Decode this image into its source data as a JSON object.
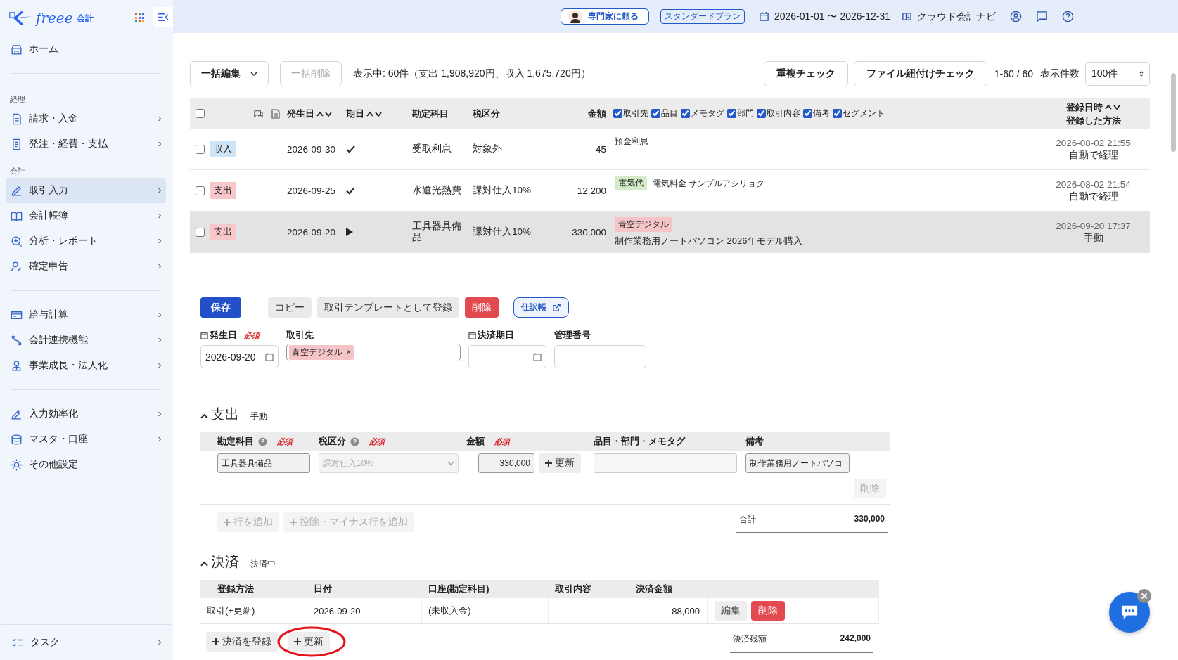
{
  "brand": {
    "name": "freee",
    "product": "会計"
  },
  "header": {
    "expert_button": "専門家に頼る",
    "plan": "スタンダードプラン",
    "period": "2026-01-01 〜 2026-12-31",
    "navi": "クラウド会計ナビ"
  },
  "sidebar": {
    "sections": [
      {
        "groups": [
          {
            "items": [
              {
                "label": "ホーム",
                "selected": false,
                "expandable": false
              }
            ]
          }
        ]
      },
      {
        "groups": [
          {
            "heading": "経理",
            "items": [
              {
                "label": "請求・入金",
                "selected": false,
                "expandable": true
              },
              {
                "label": "発注・経費・支払",
                "selected": false,
                "expandable": true
              }
            ]
          },
          {
            "heading": "会計",
            "items": [
              {
                "label": "取引入力",
                "selected": true,
                "expandable": true
              },
              {
                "label": "会計帳簿",
                "selected": false,
                "expandable": true
              },
              {
                "label": "分析・レポート",
                "selected": false,
                "expandable": true
              },
              {
                "label": "確定申告",
                "selected": false,
                "expandable": true
              }
            ]
          }
        ]
      },
      {
        "groups": [
          {
            "items": [
              {
                "label": "給与計算",
                "selected": false,
                "expandable": true
              },
              {
                "label": "会計連携機能",
                "selected": false,
                "expandable": true
              },
              {
                "label": "事業成長・法人化",
                "selected": false,
                "expandable": true
              }
            ]
          }
        ]
      },
      {
        "groups": [
          {
            "items": [
              {
                "label": "入力効率化",
                "selected": false,
                "expandable": true
              },
              {
                "label": "マスタ・口座",
                "selected": false,
                "expandable": true
              },
              {
                "label": "その他設定",
                "selected": false,
                "expandable": false
              }
            ]
          }
        ]
      }
    ],
    "task": {
      "label": "タスク",
      "expandable": true
    }
  },
  "toolbar": {
    "bulk_edit": "一括編集",
    "bulk_delete": {
      "label": "一括削除",
      "disabled": true
    },
    "summary": "表示中: 60件（支出 1,908,920円、収入 1,675,720円）",
    "buttons": [
      "重複チェック",
      "ファイル紐付けチェック"
    ],
    "range": "1-60 / 60",
    "per_page_label": "表示件数",
    "per_page": "100件"
  },
  "table": {
    "select_all": false,
    "columns": [
      {
        "label": "発生日",
        "sortable": true
      },
      {
        "label": "期日",
        "sortable": true
      },
      {
        "label": "勘定科目",
        "sortable": false
      },
      {
        "label": "税区分",
        "sortable": false
      },
      {
        "label": "金額",
        "sortable": false
      }
    ],
    "filters": [
      {
        "label": "取引先",
        "checked": true
      },
      {
        "label": "品目",
        "checked": true
      },
      {
        "label": "メモタグ",
        "checked": true
      },
      {
        "label": "部門",
        "checked": true
      },
      {
        "label": "取引内容",
        "checked": true
      },
      {
        "label": "備考",
        "checked": true
      },
      {
        "label": "セグメント",
        "checked": true
      }
    ],
    "last_column": {
      "label": "登録日時",
      "sortable": true,
      "sublabel": "登録した方法"
    },
    "rows": [
      {
        "checked": false,
        "selected": false,
        "type": "収入",
        "kind": "income",
        "date": "2026-09-30",
        "settled": true,
        "account": "受取利息",
        "tax": "対象外",
        "amount": "45",
        "detail": [
          {
            "kind": "note",
            "label": "預金利息"
          }
        ],
        "registered": "2026-08-02 21:55",
        "method": "自動で経理"
      },
      {
        "checked": false,
        "selected": false,
        "type": "支出",
        "kind": "expense",
        "date": "2026-09-25",
        "settled": true,
        "account": "水道光熱費",
        "tax": "課対仕入10%",
        "amount": "12,200",
        "detail": [
          {
            "kind": "tag",
            "label": "電気代",
            "color": "#d3ebc6"
          },
          {
            "kind": "note",
            "label": "電気料金 サンプルアシリョク"
          }
        ],
        "registered": "2026-08-02 21:54",
        "method": "自動で経理"
      },
      {
        "checked": false,
        "selected": true,
        "type": "支出",
        "kind": "expense",
        "date": "2026-09-20",
        "settled": false,
        "account": "工具器具備品",
        "tax": "課対仕入10%",
        "amount": "330,000",
        "detail": [
          {
            "kind": "tag",
            "label": "青空デジタル",
            "color": "#f5c4c7"
          },
          {
            "kind": "description",
            "label": "制作業務用ノートパソコン 2026年モデル購入"
          }
        ],
        "registered": "2026-09-20 17:37",
        "method": "手動"
      }
    ]
  },
  "form": {
    "actions": [
      {
        "kind": "primary",
        "label": "保存"
      },
      {
        "kind": "secondary",
        "label": "コピー"
      },
      {
        "kind": "secondary",
        "label": "取引テンプレートとして登録"
      },
      {
        "kind": "danger",
        "label": "削除"
      },
      {
        "kind": "outline",
        "label": "仕訳帳"
      }
    ],
    "fields": [
      {
        "kind": "date",
        "label": "発生日",
        "required": "必須",
        "value": "2026-09-20"
      },
      {
        "kind": "chips",
        "label": "取引先",
        "chips": [
          {
            "label": "青空デジタル",
            "remove": "×",
            "color": "#f5c4c7"
          }
        ]
      },
      {
        "kind": "date",
        "label": "決済期日"
      },
      {
        "kind": "text",
        "label": "管理番号"
      }
    ]
  },
  "expense": {
    "title": "支出",
    "subtitle": "手動",
    "expanded": true,
    "columns": [
      {
        "label": "勘定科目",
        "help": true,
        "required": "必須"
      },
      {
        "label": "税区分",
        "help": true,
        "required": "必須"
      },
      {
        "label": "金額",
        "help": false,
        "required": "必須"
      },
      {
        "label": "品目・部門・メモタグ",
        "help": false
      },
      {
        "label": "備考",
        "help": false
      }
    ],
    "row": {
      "account": "工具器具備品",
      "tax": "課対仕入10%",
      "tax_disabled": true,
      "amount": "330,000",
      "update": "更新",
      "note": "制作業務用ノートパソコ"
    },
    "row_delete": "削除",
    "add_buttons": [
      "行を追加",
      "控除・マイナス行を追加"
    ],
    "total_label": "合計",
    "total": "330,000"
  },
  "settlement": {
    "title": "決済",
    "subtitle": "決済中",
    "expanded": true,
    "columns": [
      "登録方法",
      "日付",
      "口座(勘定科目)",
      "取引内容",
      "決済金額"
    ],
    "rows": [
      {
        "method": "取引(+更新)",
        "date": "2026-09-20",
        "account": "(未収入金)",
        "amount": "88,000",
        "edit": "編集",
        "delete": "削除"
      }
    ],
    "buttons": [
      "決済を登録",
      "更新"
    ],
    "balance_label": "決済残額",
    "balance": "242,000"
  }
}
